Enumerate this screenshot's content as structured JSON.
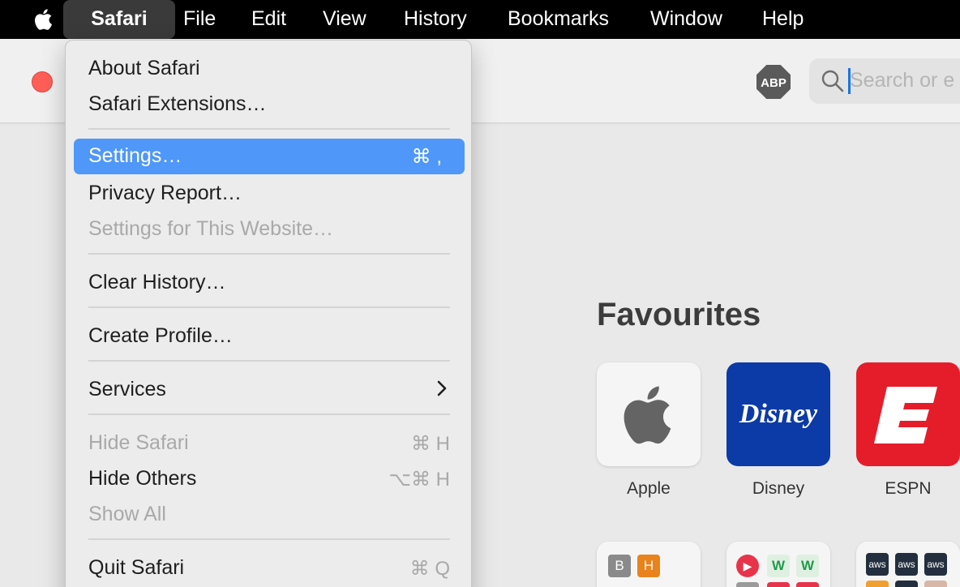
{
  "menubar": {
    "items": [
      "Safari",
      "File",
      "Edit",
      "View",
      "History",
      "Bookmarks",
      "Window",
      "Help"
    ]
  },
  "toolbar": {
    "abp_label": "ABP",
    "search_placeholder": "Search or e"
  },
  "safari_menu": {
    "about": "About Safari",
    "extensions": "Safari Extensions…",
    "settings": "Settings…",
    "settings_shortcut": "⌘ ,",
    "privacy_report": "Privacy Report…",
    "settings_website": "Settings for This Website…",
    "clear_history": "Clear History…",
    "create_profile": "Create Profile…",
    "services": "Services",
    "hide_safari": "Hide Safari",
    "hide_safari_shortcut": "⌘ H",
    "hide_others": "Hide Others",
    "hide_others_shortcut": "⌥⌘ H",
    "show_all": "Show All",
    "quit": "Quit Safari",
    "quit_shortcut": "⌘ Q"
  },
  "favourites": {
    "title": "Favourites",
    "tiles": [
      {
        "label": "Apple"
      },
      {
        "label": "Disney",
        "logo_text": "Disney"
      },
      {
        "label": "ESPN"
      }
    ],
    "row2": {
      "tile1": [
        "B",
        "H"
      ],
      "tile2": [
        "W",
        "W"
      ],
      "tile3": [
        "aws",
        "aws",
        "aws"
      ]
    }
  },
  "colors": {
    "menu_highlight": "#4f97f8",
    "disney_bg": "#0c3aa7",
    "espn_bg": "#e51d2a",
    "close_button": "#ff5f57"
  }
}
